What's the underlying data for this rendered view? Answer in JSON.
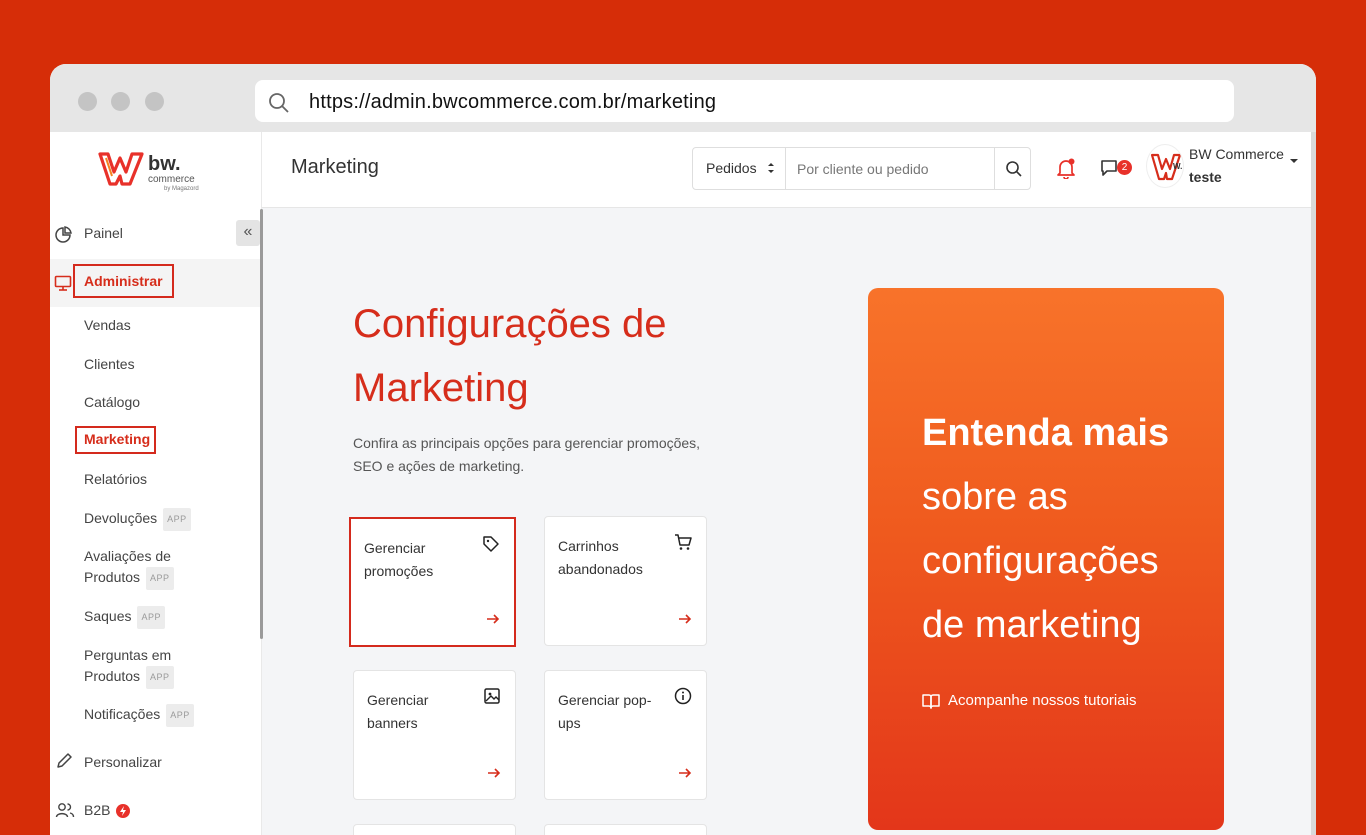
{
  "browser": {
    "url": "https://admin.bwcommerce.com.br/marketing"
  },
  "logo": {
    "brand": "bw.",
    "sub": "commerce",
    "by": "by Magazord"
  },
  "sidebar": {
    "collapse_icon": "«",
    "painel": "Painel",
    "administrar": "Administrar",
    "items": [
      {
        "label": "Vendas"
      },
      {
        "label": "Clientes"
      },
      {
        "label": "Catálogo"
      },
      {
        "label": "Marketing"
      },
      {
        "label": "Relatórios"
      },
      {
        "label": "Devoluções",
        "badge": "APP"
      },
      {
        "label": "Avaliações de",
        "label2": "Produtos",
        "badge": "APP"
      },
      {
        "label": "Saques",
        "badge": "APP"
      },
      {
        "label": "Perguntas em",
        "label2": "Produtos",
        "badge": "APP"
      },
      {
        "label": "Notificações",
        "badge": "APP"
      }
    ],
    "personalizar": "Personalizar",
    "b2b": "B2B"
  },
  "header": {
    "title": "Marketing",
    "select_value": "Pedidos",
    "search_placeholder": "Por cliente ou pedido",
    "chat_count": "2",
    "user_name": "BW Commerce",
    "user_sub": "teste"
  },
  "main": {
    "heading_line1": "Configurações de",
    "heading_line2": "Marketing",
    "description": "Confira as principais opções para gerenciar promoções, SEO e ações de marketing.",
    "cards": [
      {
        "label": "Gerenciar promoções",
        "icon": "tag-icon"
      },
      {
        "label": "Carrinhos abandonados",
        "icon": "cart-icon"
      },
      {
        "label": "Gerenciar banners",
        "icon": "image-icon"
      },
      {
        "label": "Gerenciar pop-ups",
        "icon": "info-icon"
      }
    ]
  },
  "promo": {
    "bold": "Entenda mais",
    "line1": "sobre as",
    "line2": "configurações",
    "line3": "de marketing",
    "link": "Acompanhe nossos tutoriais"
  },
  "colors": {
    "background": "#d62d08",
    "accent": "#d62d1b",
    "promo_top": "#f8732a",
    "promo_bottom": "#e3361a"
  }
}
